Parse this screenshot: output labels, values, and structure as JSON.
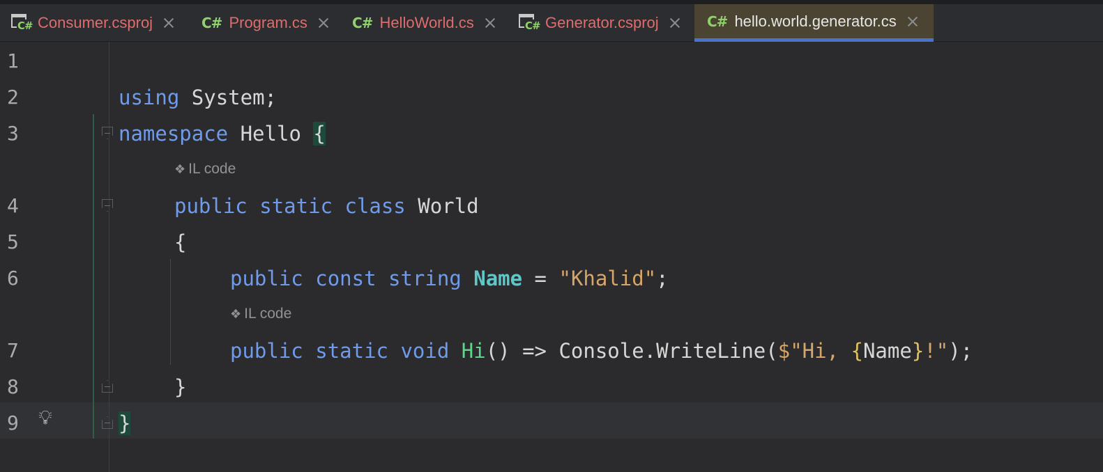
{
  "tabs": [
    {
      "label": "Consumer.csproj",
      "icon": "csproj-icon",
      "active": false
    },
    {
      "label": "Program.cs",
      "icon": "csharp-file-icon",
      "active": false
    },
    {
      "label": "HelloWorld.cs",
      "icon": "csharp-file-icon",
      "active": false
    },
    {
      "label": "Generator.csproj",
      "icon": "csproj-icon",
      "active": false
    },
    {
      "label": "hello.world.generator.cs",
      "icon": "csharp-file-icon",
      "active": true
    }
  ],
  "icon_text": {
    "csharp": "C#"
  },
  "editor": {
    "line_numbers": [
      "1",
      "2",
      "3",
      "4",
      "5",
      "6",
      "7",
      "8",
      "9"
    ],
    "code": {
      "l2_using": "using",
      "l2_system": " System;",
      "l3_namespace": "namespace",
      "l3_hello": " Hello ",
      "l3_brace": "{",
      "l4_public": "public",
      "l4_static": "static",
      "l4_class": "class",
      "l4_world": "World",
      "l5_brace": "{",
      "l6_public": "public",
      "l6_const": "const",
      "l6_string": "string",
      "l6_name": "Name",
      "l6_eq": " = ",
      "l6_value": "\"Khalid\"",
      "l6_semi": ";",
      "l7_public": "public",
      "l7_static": "static",
      "l7_void": "void",
      "l7_hi": "Hi",
      "l7_arrow": "() => Console.WriteLine(",
      "l7_str_start": "$\"Hi, ",
      "l7_interp_open": "{",
      "l7_interp_name": "Name",
      "l7_interp_close": "}",
      "l7_str_end": "!\"",
      "l7_end": ");",
      "l8_brace": "}",
      "l9_brace": "}"
    },
    "codelens": [
      {
        "label": "IL code"
      },
      {
        "label": "IL code"
      }
    ]
  },
  "colors": {
    "keyword": "#6f9bea",
    "field": "#5ec8c8",
    "method": "#5fd48a",
    "string": "#d6a56a",
    "tab_inactive_text": "#e06c6c",
    "tab_active_underline": "#4a74c9"
  }
}
